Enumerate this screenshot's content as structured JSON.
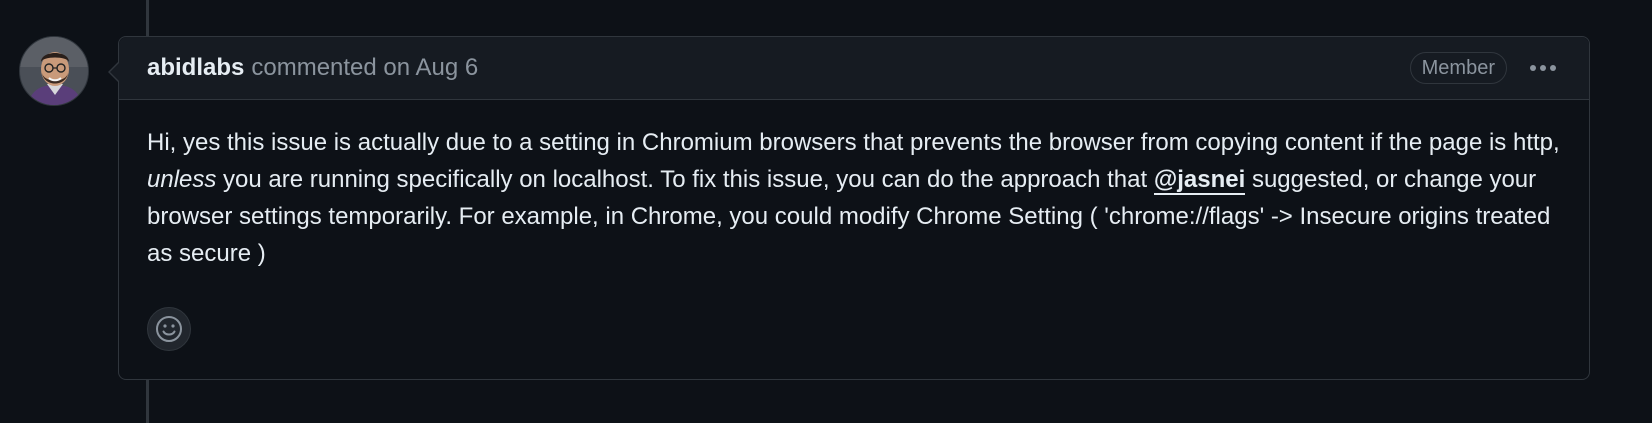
{
  "comment": {
    "author": "abidlabs",
    "meta": "commented on Aug 6",
    "role_badge": "Member",
    "more_options_icon": "kebab-horizontal-icon",
    "body": {
      "p1": "Hi, yes this issue is actually due to a setting in Chromium browsers that prevents the browser from copying content if the page is http, ",
      "emphasis": "unless",
      "p2": " you are running specifically on localhost. To fix this issue, you can do the approach that ",
      "mention": "@jasnei",
      "p3": " suggested, or change your browser settings temporarily. For example, in Chrome, you could modify Chrome Setting ( 'chrome://flags' -> Insecure origins treated as secure )"
    },
    "reaction_icon": "smiley-icon"
  },
  "colors": {
    "background": "#0d1117",
    "header_background": "#161b22",
    "border": "#30363d",
    "text_primary": "#e6edf3",
    "text_muted": "#8b949e"
  }
}
